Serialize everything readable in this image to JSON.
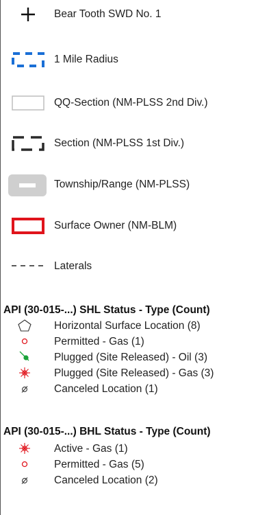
{
  "legend": {
    "items": [
      {
        "label": "Bear Tooth SWD No. 1",
        "icon": "crosshair-icon"
      },
      {
        "label": "1 Mile Radius",
        "icon": "dashed-blue-box-icon"
      },
      {
        "label": "QQ-Section (NM-PLSS 2nd Div.)",
        "icon": "light-gray-box-icon"
      },
      {
        "label": "Section (NM-PLSS 1st Div.)",
        "icon": "dark-dashed-box-icon"
      },
      {
        "label": "Township/Range (NM-PLSS)",
        "icon": "gray-filled-box-icon"
      },
      {
        "label": "Surface Owner (NM-BLM)",
        "icon": "red-box-icon"
      },
      {
        "label": "Laterals",
        "icon": "dashed-line-icon"
      }
    ],
    "shl": {
      "title": "API (30-015-...) SHL Status - Type (Count)",
      "items": [
        {
          "label": "Horizontal Surface Location (8)",
          "icon": "pentagon-icon"
        },
        {
          "label": "Permitted - Gas (1)",
          "icon": "red-circle-icon"
        },
        {
          "label": "Plugged (Site Released) - Oil (3)",
          "icon": "green-dot-slash-icon"
        },
        {
          "label": "Plugged (Site Released) - Gas (3)",
          "icon": "red-star-slash-icon"
        },
        {
          "label": "Canceled Location (1)",
          "icon": "empty-set-icon"
        }
      ]
    },
    "bhl": {
      "title": "API (30-015-...) BHL Status - Type (Count)",
      "items": [
        {
          "label": "Active - Gas (1)",
          "icon": "red-star-icon"
        },
        {
          "label": "Permitted - Gas (5)",
          "icon": "red-circle-icon"
        },
        {
          "label": "Canceled Location (2)",
          "icon": "empty-set-icon"
        }
      ]
    },
    "colors": {
      "radius_blue": "#1a6fd6",
      "owner_red": "#e0141c",
      "township_gray": "#cfcfcf",
      "green": "#1aa33a"
    }
  }
}
